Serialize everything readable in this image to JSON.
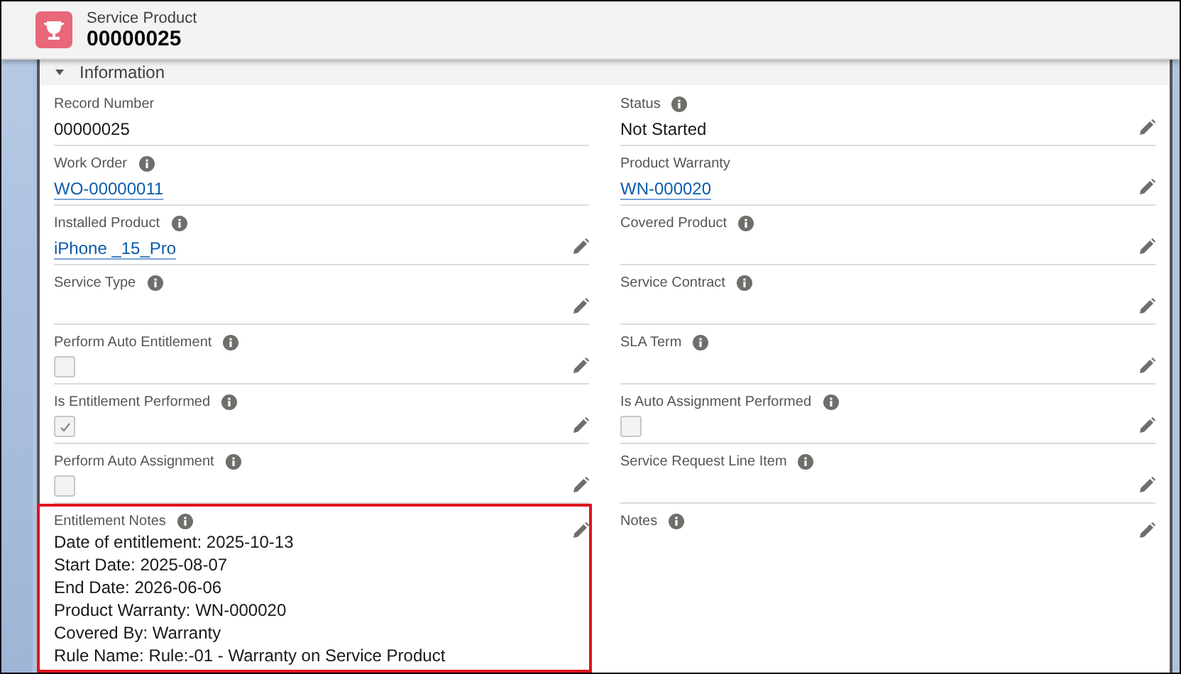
{
  "header": {
    "object_type": "Service Product",
    "record_name": "00000025"
  },
  "section": {
    "title": "Information",
    "expanded": true
  },
  "fields": [
    {
      "label": "Record Number",
      "info": false,
      "editable": false,
      "kind": "text",
      "value": "00000025"
    },
    {
      "label": "Status",
      "info": true,
      "editable": true,
      "kind": "text",
      "value": "Not Started"
    },
    {
      "label": "Work Order",
      "info": true,
      "editable": false,
      "kind": "link",
      "value": "WO-00000011"
    },
    {
      "label": "Product Warranty",
      "info": false,
      "editable": true,
      "kind": "link",
      "value": "WN-000020"
    },
    {
      "label": "Installed Product",
      "info": true,
      "editable": true,
      "kind": "link",
      "value": "iPhone _15_Pro"
    },
    {
      "label": "Covered Product",
      "info": true,
      "editable": true,
      "kind": "text"
    },
    {
      "label": "Service Type",
      "info": true,
      "editable": true,
      "kind": "text"
    },
    {
      "label": "Service Contract",
      "info": true,
      "editable": true,
      "kind": "text"
    },
    {
      "label": "Perform Auto Entitlement",
      "info": true,
      "editable": true,
      "kind": "checkbox",
      "checked": false
    },
    {
      "label": "SLA Term",
      "info": true,
      "editable": true,
      "kind": "text"
    },
    {
      "label": "Is Entitlement Performed",
      "info": true,
      "editable": true,
      "kind": "checkbox",
      "checked": true
    },
    {
      "label": "Is Auto Assignment Performed",
      "info": true,
      "editable": true,
      "kind": "checkbox",
      "checked": false
    },
    {
      "label": "Perform Auto Assignment",
      "info": true,
      "editable": true,
      "kind": "checkbox",
      "checked": false
    },
    {
      "label": "Service Request Line Item",
      "info": true,
      "editable": true,
      "kind": "text"
    },
    {
      "label": "Entitlement Notes",
      "info": true,
      "editable": true,
      "kind": "notes",
      "highlighted": true,
      "lines": [
        "Date of entitlement: 2025-10-13",
        "Start Date: 2025-08-07",
        "End Date: 2026-06-06",
        "Product Warranty: WN-000020",
        "Covered By: Warranty",
        "Rule Name: Rule:-01 - Warranty on Service Product"
      ]
    },
    {
      "label": "Notes",
      "info": true,
      "editable": true,
      "kind": "notes",
      "highlighted": false
    }
  ]
}
